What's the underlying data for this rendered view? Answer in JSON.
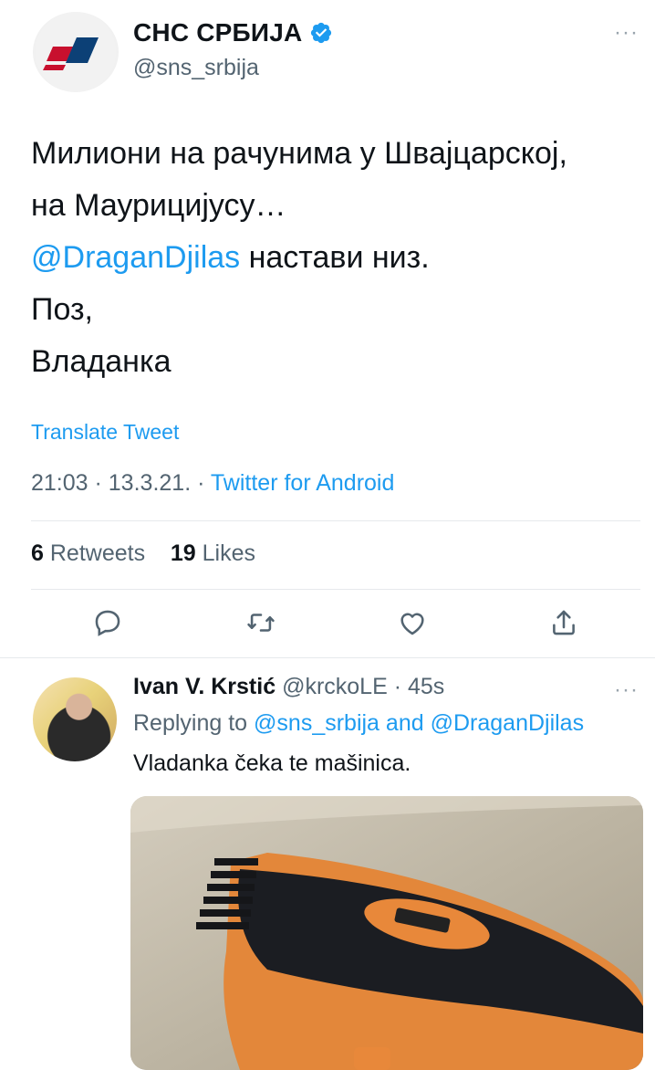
{
  "author": {
    "display_name": "СНС СРБИЈА",
    "handle": "@sns_srbija",
    "verified": true,
    "more": "···"
  },
  "tweet": {
    "lines": [
      "Милиони на рачунима у Швајцарској,",
      "на Маурицијусу…"
    ],
    "mention": "@DraganDjilas",
    "mention_suffix": " настави низ.",
    "line4": "Поз,",
    "line5": "Владанка",
    "translate_label": "Translate Tweet",
    "time": "21:03",
    "date": "13.3.21.",
    "separator": " · ",
    "source": "Twitter for Android"
  },
  "stats": {
    "retweets_count": "6",
    "retweets_label": "Retweets",
    "likes_count": "19",
    "likes_label": "Likes"
  },
  "actions": {
    "icons": [
      "reply-icon",
      "retweet-icon",
      "like-icon",
      "share-icon"
    ]
  },
  "reply": {
    "name": "Ivan V. Krstić",
    "handle": "@krckoLE",
    "age": "45s",
    "separator": " · ",
    "replying_prefix": "Replying to",
    "replying_to_1": "@sns_srbija",
    "replying_and": "and",
    "replying_to_2": "@DraganDjilas",
    "text": "Vladanka čeka te mašinica.",
    "more": "···"
  },
  "colors": {
    "accent": "#1d9bf0",
    "secondary_text": "#536471",
    "primary_text": "#0f1419",
    "divider": "#e6e9ec"
  }
}
